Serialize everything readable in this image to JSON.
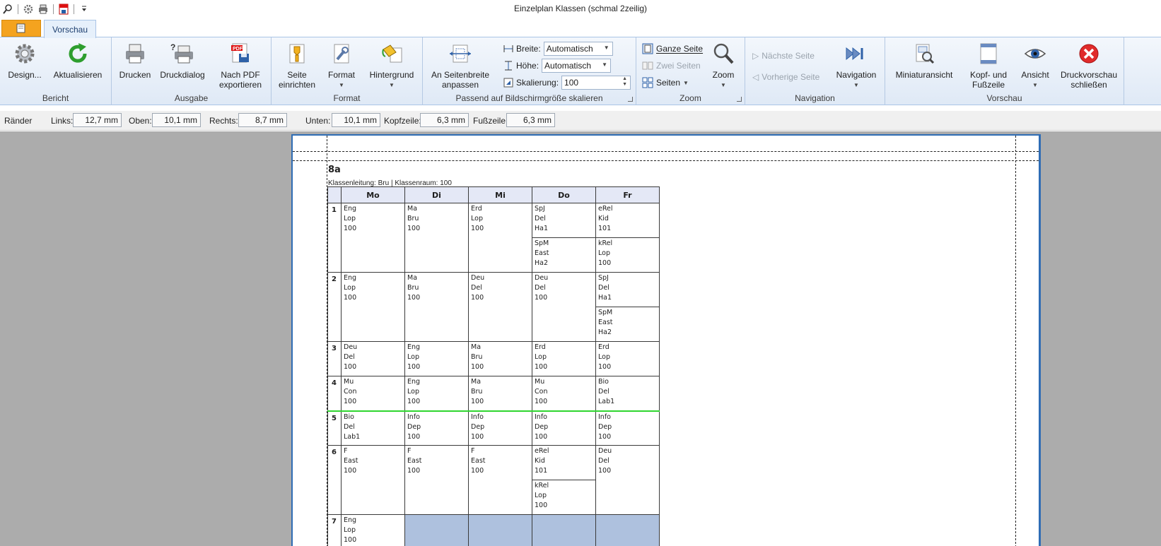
{
  "window": {
    "title": "Einzelplan Klassen (schmal 2zeilig)"
  },
  "quick_access": [
    "search-icon",
    "gear-icon",
    "printer-icon",
    "pdf-save-icon",
    "customize-arrow-icon"
  ],
  "tabs": {
    "file_icon": "document-icon",
    "active": "Vorschau"
  },
  "ribbon": {
    "bericht": {
      "label": "Bericht",
      "design": "Design...",
      "aktualisieren": "Aktualisieren"
    },
    "ausgabe": {
      "label": "Ausgabe",
      "drucken": "Drucken",
      "druckdialog": "Druckdialog",
      "pdf_1": "Nach PDF",
      "pdf_2": "exportieren"
    },
    "format": {
      "label": "Format",
      "seite_1": "Seite",
      "seite_2": "einrichten",
      "format": "Format",
      "hintergrund": "Hintergrund"
    },
    "passend": {
      "label": "Passend auf Bildschirmgröße skalieren",
      "seitenbreite_1": "An Seitenbreite",
      "seitenbreite_2": "anpassen",
      "breite_label": "Breite:",
      "breite_value": "Automatisch",
      "hoehe_label": "Höhe:",
      "hoehe_value": "Automatisch",
      "skalierung_label": "Skalierung:",
      "skalierung_value": "100"
    },
    "zoom": {
      "label": "Zoom",
      "ganze_seite": "Ganze Seite",
      "zwei_seiten": "Zwei Seiten",
      "seiten": "Seiten",
      "zoom": "Zoom"
    },
    "navigation": {
      "label": "Navigation",
      "naechste": "Nächste Seite",
      "vorherige": "Vorherige Seite",
      "navigation": "Navigation"
    },
    "vorschau": {
      "label": "Vorschau",
      "miniatur": "Miniaturansicht",
      "kopf_1": "Kopf- und",
      "kopf_2": "Fußzeile",
      "ansicht": "Ansicht",
      "schliessen_1": "Druckvorschau",
      "schliessen_2": "schließen"
    }
  },
  "margins": {
    "title": "Ränder",
    "links_label": "Links:",
    "links": "12,7 mm",
    "oben_label": "Oben:",
    "oben": "10,1 mm",
    "rechts_label": "Rechts:",
    "rechts": "8,7 mm",
    "unten_label": "Unten:",
    "unten": "10,1 mm",
    "kopf_label": "Kopfzeile:",
    "kopf": "6,3 mm",
    "fuss_label": "Fußzeile:",
    "fuss": "6,3 mm"
  },
  "page": {
    "class_name": "8a",
    "subtitle": "Klassenleitung: Bru | Klassenraum: 100",
    "days": [
      "Mo",
      "Di",
      "Mi",
      "Do",
      "Fr"
    ],
    "rows": [
      {
        "period": "1",
        "cells": [
          "Eng\nLop\n100",
          "Ma\nBru\n100",
          "Erd\nLop\n100",
          "SpJ\nDel\nHa1",
          "eRel\nKid\n101"
        ],
        "second": {
          "Do": "SpM\nEast\nHa2",
          "Fr": "kRel\nLop\n100"
        }
      },
      {
        "period": "2",
        "cells": [
          "Eng\nLop\n100",
          "Ma\nBru\n100",
          "Deu\nDel\n100",
          "Deu\nDel\n100",
          "SpJ\nDel\nHa1"
        ],
        "second": {
          "Fr": "SpM\nEast\nHa2"
        }
      },
      {
        "period": "3",
        "cells": [
          "Deu\nDel\n100",
          "Eng\nLop\n100",
          "Ma\nBru\n100",
          "Erd\nLop\n100",
          "Erd\nLop\n100"
        ]
      },
      {
        "period": "4",
        "cells": [
          "Mu\nCon\n100",
          "Eng\nLop\n100",
          "Ma\nBru\n100",
          "Mu\nCon\n100",
          "Bio\nDel\nLab1"
        ]
      },
      {
        "period": "5",
        "cells": [
          "Bio\nDel\nLab1",
          "Info\nDep\n100",
          "Info\nDep\n100",
          "Info\nDep\n100",
          "Info\nDep\n100"
        ]
      },
      {
        "period": "6",
        "cells": [
          "F\nEast\n100",
          "F\nEast\n100",
          "F\nEast\n100",
          "eRel\nKid\n101",
          "Deu\nDel\n100"
        ],
        "second": {
          "Do": "kRel\nLop\n100"
        }
      },
      {
        "period": "7",
        "cells": [
          "Eng\nLop\n100",
          "",
          "",
          "",
          ""
        ]
      }
    ],
    "colors": {
      "empty_cell": "#aec1de",
      "header_bg": "#e4e8f6",
      "highlight_line": "#2fd62f",
      "page_border": "#2f6db5"
    }
  }
}
